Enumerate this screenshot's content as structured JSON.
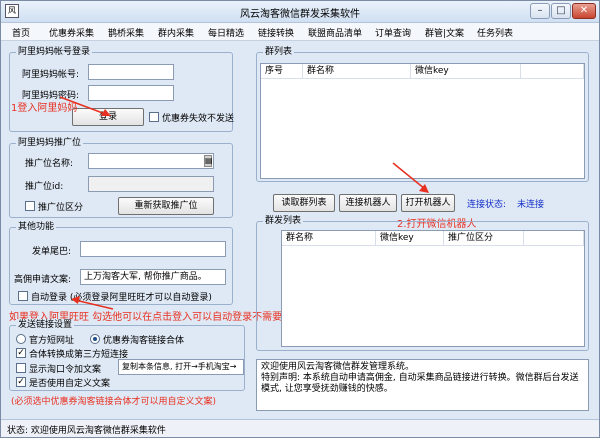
{
  "window": {
    "title": "风云淘客微信群发采集软件",
    "icon": "风",
    "min": "–",
    "max": "□",
    "close": "✕"
  },
  "menu": [
    "首页",
    "优惠券采集",
    "鹊桥采集",
    "群内采集",
    "每日精选",
    "链接转换",
    "联盟商品清单",
    "订单查询",
    "群管|文案",
    "任务列表"
  ],
  "account": {
    "group_title": "阿里妈妈帐号登录",
    "account_label": "阿里妈妈帐号:",
    "account_value": "",
    "password_label": "阿里妈妈密码:",
    "password_value": "",
    "login_button": "登录",
    "coupon_check_label": "优惠券失效不发送"
  },
  "annotations": {
    "login": "1登入阿里妈妈",
    "robot": "2.打开微信机器人",
    "auto_login": "如果登入阿里旺旺 勾选他可以在点击登入可以自动登录不需要输密码, 也可以挂机掉线自连",
    "custom_note": "(必须选中优惠券淘客链接合体才可以用自定义文案)"
  },
  "ad_slot": {
    "group_title": "阿里妈妈推广位",
    "name_label": "推广位名称:",
    "name_value": "",
    "dropdown_glyph": "▤",
    "id_label": "推广位id:",
    "id_value": "",
    "distinguish_label": "推广位区分",
    "refetch_button": "重新获取推广位"
  },
  "other": {
    "group_title": "其他功能",
    "tail_label": "发单尾巴:",
    "tail_value": "",
    "copy_label": "高佣申请文案:",
    "copy_value": "上万淘客大军, 帮你推广商品。",
    "auto_login_label": "自动登录 (必须登录阿里旺旺才可以自动登录)"
  },
  "send": {
    "group_title": "发送链接设置",
    "official_label": "官方短网址",
    "coupon_combo_label": "优惠券淘客链接合体",
    "combo_third_label": "合体转换成第三方短连接",
    "show_taopwd_label": "显示淘口令加文案",
    "taopwd_value": "复制本条信息, 打开→手机淘宝→",
    "custom_copy_label": "是否使用自定义文案"
  },
  "groups": {
    "group_title": "群列表",
    "columns": [
      "序号",
      "群名称",
      "微信key"
    ]
  },
  "actions": {
    "read_groups": "读取群列表",
    "connect_robot": "连接机器人",
    "open_robot": "打开机器人",
    "status_label": "连接状态:",
    "status_value": "未连接"
  },
  "send_list": {
    "group_title": "群发列表",
    "columns": [
      "群名称",
      "微信key",
      "推广位区分"
    ]
  },
  "log": {
    "lines": [
      "欢迎使用风云淘客微信群发管理系统。",
      "特别声明: 本系统自动申请高佣金, 自动采集商品链接进行转换。微信群后台发送模式, 让您享受抚劲赚钱的快感。"
    ]
  },
  "statusbar": {
    "text": "状态: 欢迎使用风云淘客微信群采集软件"
  },
  "colors": {
    "annotation": "#e83020",
    "link_status": "#1530c8",
    "window_bg": "#dfe9f5"
  }
}
